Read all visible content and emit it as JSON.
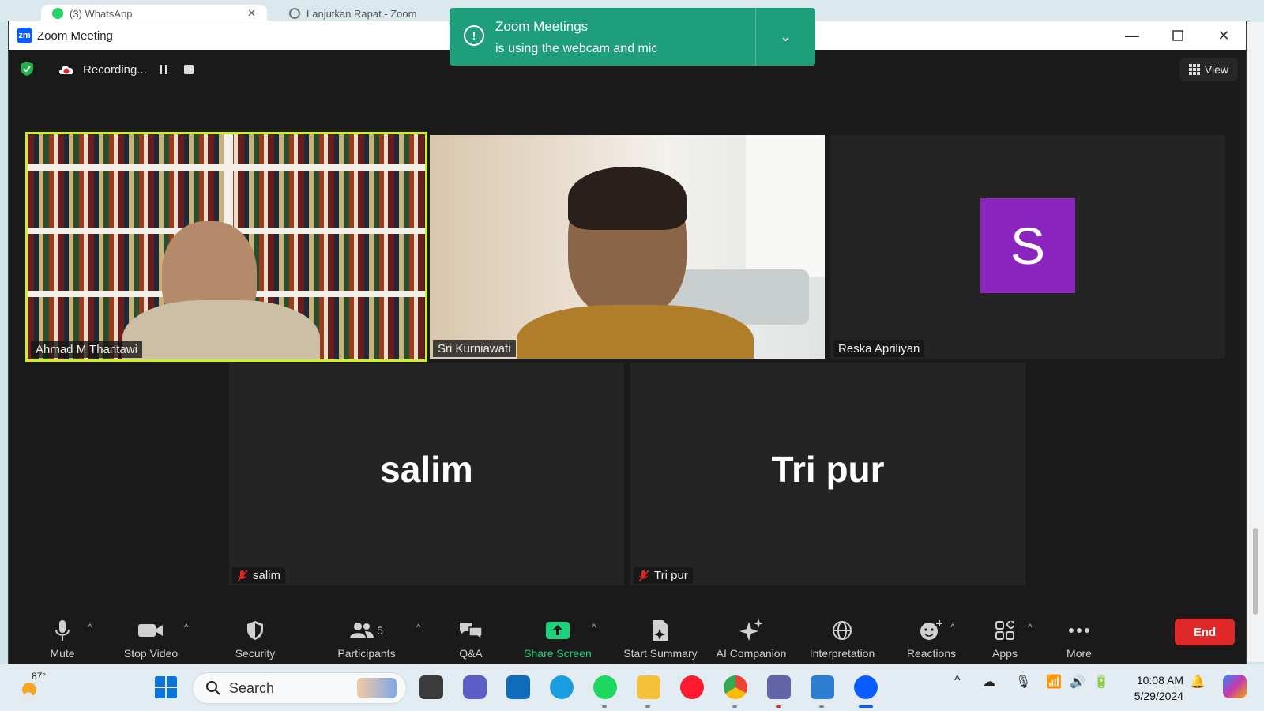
{
  "browser": {
    "tabs": [
      {
        "label": "(3) WhatsApp"
      },
      {
        "label": "Lanjutkan Rapat - Zoom"
      }
    ]
  },
  "window": {
    "title": "Zoom Meeting",
    "logo_text": "zm"
  },
  "topbar": {
    "recording_label": "Recording...",
    "view_label": "View"
  },
  "notification": {
    "title": "Zoom Meetings",
    "message": "is using the webcam and mic"
  },
  "participants": [
    {
      "name": "Ahmad M Thantawi",
      "type": "video",
      "speaking": true,
      "muted": false
    },
    {
      "name": "Sri Kurniawati",
      "type": "video",
      "speaking": false,
      "muted": false
    },
    {
      "name": "Reska Apriliyan",
      "type": "avatar",
      "initial": "S",
      "avatar_color": "#8c25bf",
      "muted": false
    },
    {
      "name": "salim",
      "display": "salim",
      "type": "name",
      "muted": true
    },
    {
      "name": "Tri pur",
      "display": "Tri pur",
      "type": "name",
      "muted": true
    }
  ],
  "toolbar": {
    "mute": "Mute",
    "stop_video": "Stop Video",
    "security": "Security",
    "participants": "Participants",
    "participants_count": "5",
    "qa": "Q&A",
    "share_screen": "Share Screen",
    "start_summary": "Start Summary",
    "ai_companion": "AI Companion",
    "interpretation": "Interpretation",
    "reactions": "Reactions",
    "apps": "Apps",
    "more": "More",
    "end": "End"
  },
  "taskbar": {
    "temperature": "87°",
    "search_placeholder": "Search",
    "time": "10:08 AM",
    "date": "5/29/2024"
  },
  "colors": {
    "zoom_blue": "#0b5cff",
    "share_green": "#1fd17a",
    "end_red": "#e02828",
    "speaking_outline": "#c9f02a",
    "notification_bg": "#1e9e7a"
  }
}
